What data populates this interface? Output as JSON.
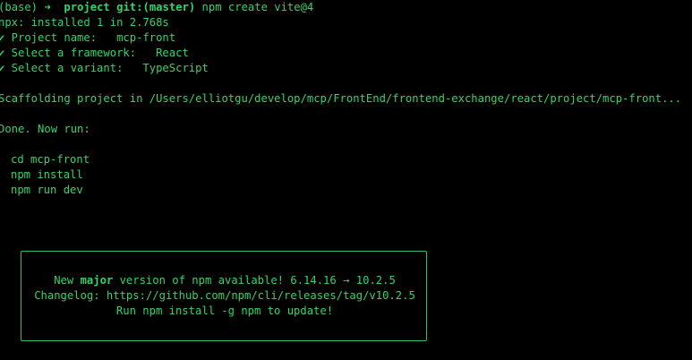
{
  "prompt": {
    "env": "(base)",
    "arrow": "➜",
    "directory": "project",
    "git_label": "git:(",
    "branch": "master",
    "git_close": ")",
    "command": "npm create vite@4"
  },
  "output": {
    "npx_installed": "npx: installed 1 in 2.768s",
    "project_name": "✔ Project name:   mcp-front",
    "framework": "✔ Select a framework:   React",
    "variant": "✔ Select a variant:   TypeScript",
    "scaffolding": "Scaffolding project in /Users/elliotgu/develop/mcp/FrontEnd/frontend-exchange/react/project/mcp-front...",
    "done": "Done. Now run:",
    "next_steps": [
      "cd mcp-front",
      "npm install",
      "npm run dev"
    ]
  },
  "notice": {
    "line1_prefix": "New ",
    "line1_major": "major",
    "line1_middle": " version of npm available! ",
    "line1_old": "6.14.16",
    "line1_arrow": " → ",
    "line1_new": "10.2.5",
    "line2_prefix": "Changelog: ",
    "line2_url": "https://github.com/npm/cli/releases/tag/v10.2.5",
    "line3_prefix": "Run ",
    "line3_cmd": "npm install -g npm",
    "line3_suffix": " to update!"
  },
  "colors": {
    "background": "#000000",
    "text": "#33d46a",
    "border": "#2fbf60"
  }
}
